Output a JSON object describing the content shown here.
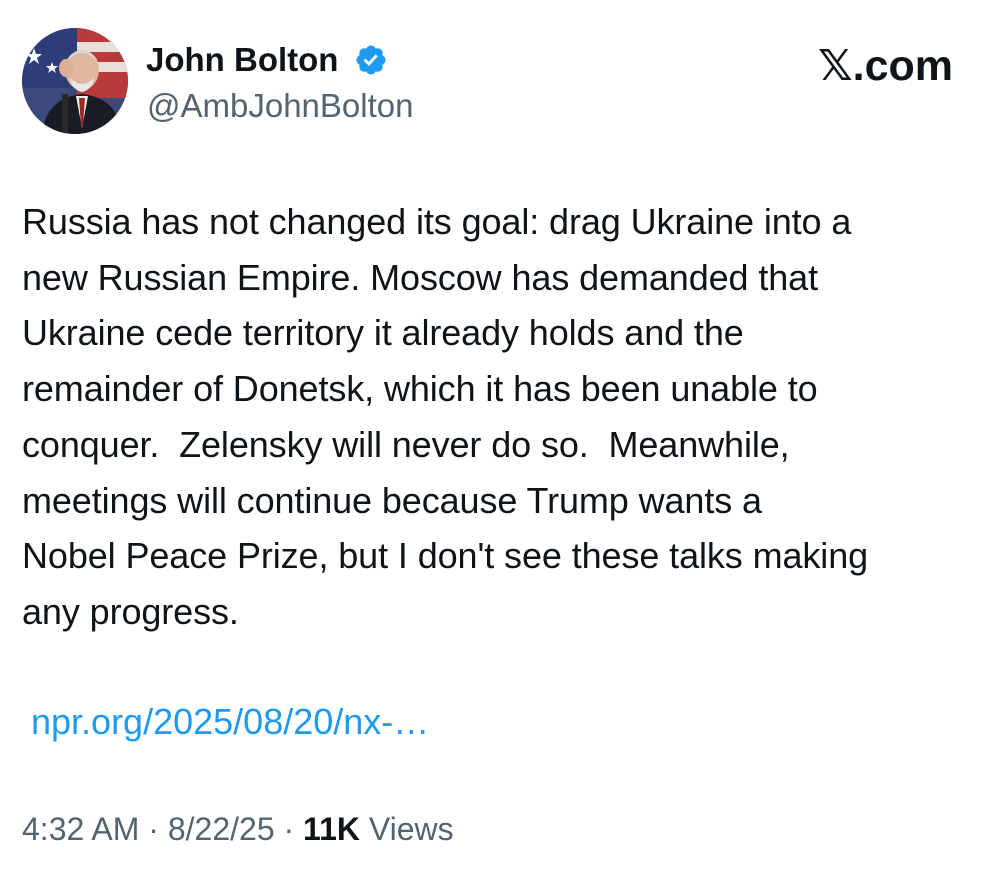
{
  "author": {
    "display_name": "John Bolton",
    "handle": "@AmbJohnBolton",
    "verified": true,
    "avatar_icon": "profile-photo"
  },
  "brand": "𝕏.com",
  "tweet": {
    "text_lines": [
      "Russia has not changed its goal: drag Ukraine into a",
      "new Russian Empire. Moscow has demanded that",
      "Ukraine cede territory it already holds and the",
      "remainder of Donetsk, which it has been unable to",
      "conquer.  Zelensky will never do so.  Meanwhile,",
      "meetings will continue because Trump wants a",
      "Nobel Peace Prize, but I don't see these talks making",
      "any progress."
    ],
    "link": "npr.org/2025/08/20/nx-…"
  },
  "meta": {
    "time": "4:32 AM",
    "separator": "·",
    "date": "8/22/25",
    "views_count": "11K",
    "views_label": "Views"
  },
  "colors": {
    "text": "#0f1419",
    "secondary": "#536471",
    "link": "#1d9bf0",
    "verified_badge": "#1d9bf0"
  }
}
